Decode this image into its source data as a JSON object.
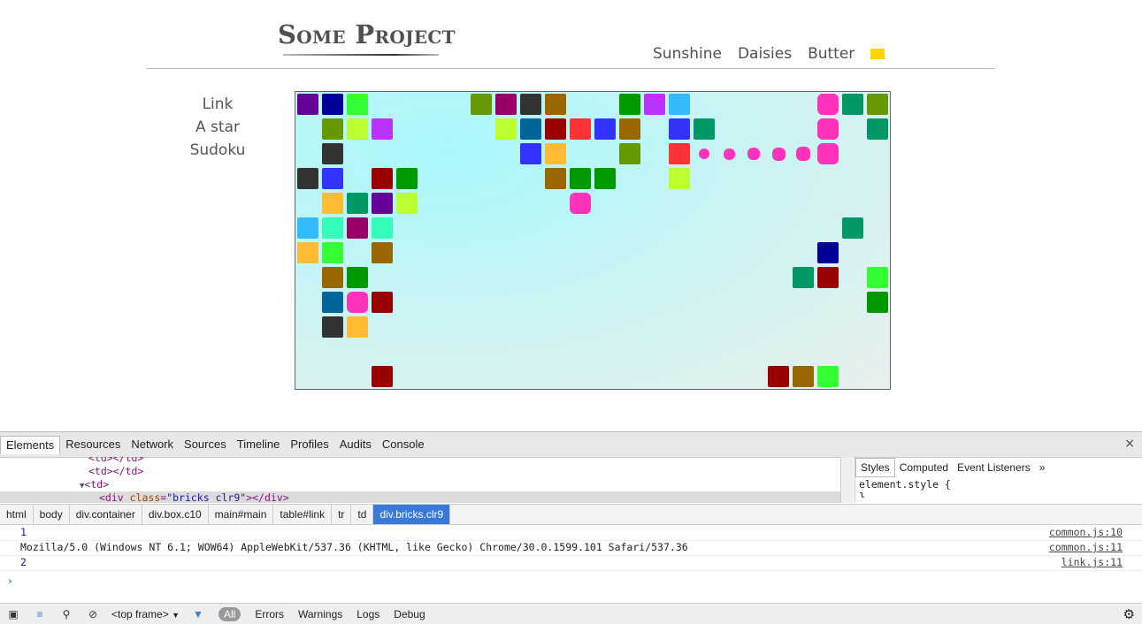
{
  "site": {
    "brand": "Some Project",
    "topnav": [
      "Sunshine",
      "Daisies",
      "Butter"
    ],
    "swatch_color": "#ffd500",
    "sidenav": [
      "Link",
      "A star",
      "Sudoku"
    ]
  },
  "board": {
    "cols": 24,
    "rows": 12,
    "bricks": [
      [
        0,
        0,
        "#660099"
      ],
      [
        1,
        0,
        "#000099"
      ],
      [
        2,
        0,
        "#33ff33"
      ],
      [
        7,
        0,
        "#669900"
      ],
      [
        8,
        0,
        "#990066"
      ],
      [
        9,
        0,
        "#333333"
      ],
      [
        10,
        0,
        "#996600"
      ],
      [
        13,
        0,
        "#009900"
      ],
      [
        14,
        0,
        "#bb33ff"
      ],
      [
        15,
        0,
        "#33bbff"
      ],
      [
        21,
        0,
        "#ff33bb"
      ],
      [
        22,
        0,
        "#009966"
      ],
      [
        23,
        0,
        "#669900"
      ],
      [
        1,
        1,
        "#669900"
      ],
      [
        2,
        1,
        "#bbff33"
      ],
      [
        3,
        1,
        "#bb33ff"
      ],
      [
        8,
        1,
        "#bbff33"
      ],
      [
        9,
        1,
        "#006699"
      ],
      [
        10,
        1,
        "#990000"
      ],
      [
        11,
        1,
        "#ff3333"
      ],
      [
        12,
        1,
        "#3333ff"
      ],
      [
        13,
        1,
        "#996600"
      ],
      [
        15,
        1,
        "#3333ff"
      ],
      [
        16,
        1,
        "#009966"
      ],
      [
        21,
        1,
        "#ff33bb"
      ],
      [
        23,
        1,
        "#009966"
      ],
      [
        1,
        2,
        "#333333"
      ],
      [
        9,
        2,
        "#3333ff"
      ],
      [
        10,
        2,
        "#ffbb33"
      ],
      [
        13,
        2,
        "#669900"
      ],
      [
        15,
        2,
        "#ff3333"
      ],
      [
        21,
        2,
        "#ff33bb"
      ],
      [
        0,
        3,
        "#333333"
      ],
      [
        1,
        3,
        "#3333ff"
      ],
      [
        3,
        3,
        "#990000"
      ],
      [
        4,
        3,
        "#009900"
      ],
      [
        10,
        3,
        "#996600"
      ],
      [
        11,
        3,
        "#009900"
      ],
      [
        12,
        3,
        "#009900"
      ],
      [
        15,
        3,
        "#bbff33"
      ],
      [
        1,
        4,
        "#ffbb33"
      ],
      [
        2,
        4,
        "#009966"
      ],
      [
        3,
        4,
        "#660099"
      ],
      [
        4,
        4,
        "#bbff33"
      ],
      [
        11,
        4,
        "#ff33bb"
      ],
      [
        0,
        5,
        "#33bbff"
      ],
      [
        1,
        5,
        "#33ffbb"
      ],
      [
        2,
        5,
        "#990066"
      ],
      [
        3,
        5,
        "#33ffbb"
      ],
      [
        22,
        5,
        "#009966"
      ],
      [
        0,
        6,
        "#ffbb33"
      ],
      [
        1,
        6,
        "#33ff33"
      ],
      [
        3,
        6,
        "#996600"
      ],
      [
        21,
        6,
        "#000099"
      ],
      [
        1,
        7,
        "#996600"
      ],
      [
        2,
        7,
        "#009900"
      ],
      [
        20,
        7,
        "#009966"
      ],
      [
        21,
        7,
        "#990000"
      ],
      [
        23,
        7,
        "#33ff33"
      ],
      [
        1,
        8,
        "#006699"
      ],
      [
        2,
        8,
        "#ff33bb"
      ],
      [
        3,
        8,
        "#990000"
      ],
      [
        23,
        8,
        "#009900"
      ],
      [
        1,
        9,
        "#333333"
      ],
      [
        2,
        9,
        "#ffbb33"
      ],
      [
        3,
        11,
        "#990000"
      ],
      [
        19,
        11,
        "#990000"
      ],
      [
        20,
        11,
        "#996600"
      ],
      [
        21,
        11,
        "#33ff33"
      ]
    ],
    "path_dots": [
      [
        16,
        2
      ],
      [
        17,
        2
      ],
      [
        18,
        2
      ],
      [
        19,
        2
      ],
      [
        20,
        2
      ]
    ],
    "path_color": "#ff33bb"
  },
  "devtools": {
    "tabs": [
      "Elements",
      "Resources",
      "Network",
      "Sources",
      "Timeline",
      "Profiles",
      "Audits",
      "Console"
    ],
    "active_tab": "Elements",
    "close_icon": "×",
    "dom": {
      "line0": "<td></td>",
      "line1": "<td></td>",
      "line2_arrow": "▼",
      "line2": "<td>",
      "line3_open": "<div ",
      "line3_attr": "class",
      "line3_val": "\"bricks clr9\"",
      "line3_close": "></div>"
    },
    "side_tabs": [
      "Styles",
      "Computed",
      "Event Listeners",
      "»"
    ],
    "side_rule": "element.style {",
    "side_rule_end": "}",
    "crumbs": [
      "html",
      "body",
      "div.container",
      "div.box.c10",
      "main#main",
      "table#link",
      "tr",
      "td",
      "div.bricks.clr9"
    ],
    "active_crumb": "div.bricks.clr9",
    "console": [
      {
        "msg": "1",
        "src": "common.js:10",
        "num": true
      },
      {
        "msg": "Mozilla/5.0 (Windows NT 6.1; WOW64) AppleWebKit/537.36 (KHTML, like Gecko) Chrome/30.0.1599.101 Safari/537.36",
        "src": "common.js:11",
        "num": false
      },
      {
        "msg": "2",
        "src": "link.js:11",
        "num": true
      }
    ],
    "prompt": "›",
    "status": {
      "frame": "<top frame>",
      "frame_arrow": "▼",
      "all": "All",
      "levels": [
        "Errors",
        "Warnings",
        "Logs",
        "Debug"
      ]
    }
  }
}
